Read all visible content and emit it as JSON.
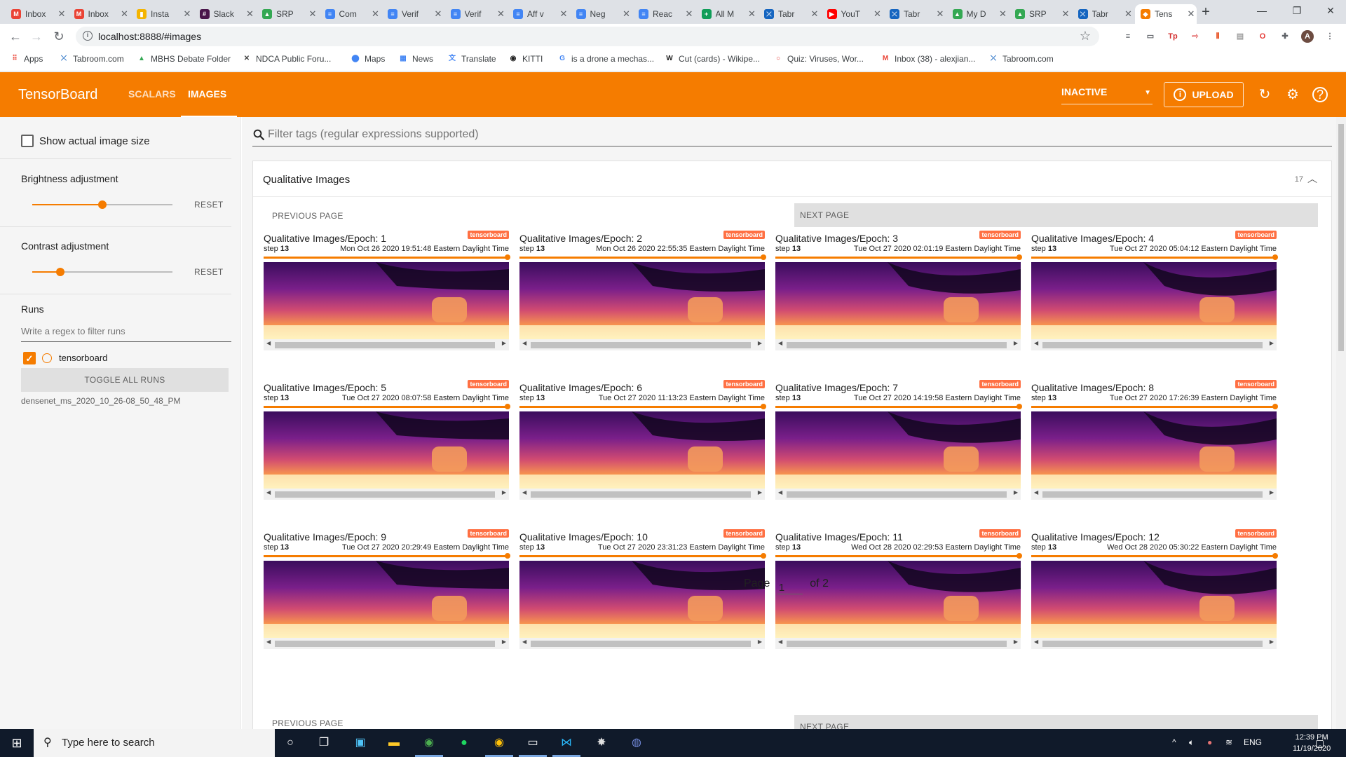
{
  "browser": {
    "tabs": [
      {
        "label": "Inbox",
        "fav": "M",
        "color": "#ea4335"
      },
      {
        "label": "Inbox",
        "fav": "M",
        "color": "#ea4335"
      },
      {
        "label": "Insta",
        "fav": "▮",
        "color": "#f4b400"
      },
      {
        "label": "Slack",
        "fav": "#",
        "color": "#4a154b"
      },
      {
        "label": "SRP",
        "fav": "▲",
        "color": "#34a853"
      },
      {
        "label": "Com",
        "fav": "≡",
        "color": "#4285f4"
      },
      {
        "label": "Verif",
        "fav": "≡",
        "color": "#4285f4"
      },
      {
        "label": "Verif",
        "fav": "≡",
        "color": "#4285f4"
      },
      {
        "label": "Aff v",
        "fav": "≡",
        "color": "#4285f4"
      },
      {
        "label": "Neg",
        "fav": "≡",
        "color": "#4285f4"
      },
      {
        "label": "Reac",
        "fav": "≡",
        "color": "#4285f4"
      },
      {
        "label": "All M",
        "fav": "+",
        "color": "#0f9d58"
      },
      {
        "label": "Tabr",
        "fav": "⤫",
        "color": "#1565c0"
      },
      {
        "label": "YouT",
        "fav": "▶",
        "color": "#ff0000"
      },
      {
        "label": "Tabr",
        "fav": "⤫",
        "color": "#1565c0"
      },
      {
        "label": "My D",
        "fav": "▲",
        "color": "#34a853"
      },
      {
        "label": "SRP",
        "fav": "▲",
        "color": "#34a853"
      },
      {
        "label": "Tabr",
        "fav": "⤫",
        "color": "#1565c0"
      },
      {
        "label": "Tens",
        "fav": "◆",
        "color": "#f57c00",
        "active": true
      }
    ],
    "url": "localhost:8888/#images",
    "bookmarks": [
      {
        "label": "Apps",
        "icon": "apps-grid-icon"
      },
      {
        "label": "Tabroom.com",
        "icon": "tabroom-icon"
      },
      {
        "label": "MBHS Debate Folder",
        "icon": "drive-icon"
      },
      {
        "label": "NDCA Public Foru...",
        "icon": "ndca-icon"
      },
      {
        "label": "Maps",
        "icon": "maps-pin-icon"
      },
      {
        "label": "News",
        "icon": "news-icon"
      },
      {
        "label": "Translate",
        "icon": "translate-icon"
      },
      {
        "label": "KITTI",
        "icon": "github-icon"
      },
      {
        "label": "is a drone a mechas...",
        "icon": "google-icon"
      },
      {
        "label": "Cut (cards) - Wikipe...",
        "icon": "wikipedia-icon"
      },
      {
        "label": "Quiz: Viruses, Wor...",
        "icon": "quiz-icon"
      },
      {
        "label": "Inbox (38) - alexjian...",
        "icon": "gmail-icon"
      },
      {
        "label": "Tabroom.com",
        "icon": "tabroom-icon"
      }
    ]
  },
  "tensorboard": {
    "logo": "TensorBoard",
    "tabs": [
      "SCALARS",
      "IMAGES"
    ],
    "active_tab": "IMAGES",
    "status": "INACTIVE",
    "upload_label": "UPLOAD",
    "accent": "#f57c00"
  },
  "sidebar": {
    "show_actual_size": "Show actual image size",
    "brightness": {
      "label": "Brightness adjustment",
      "reset": "RESET",
      "value": 0.5
    },
    "contrast": {
      "label": "Contrast adjustment",
      "reset": "RESET",
      "value": 0.2
    },
    "runs_title": "Runs",
    "runs_filter_placeholder": "Write a regex to filter runs",
    "run_name": "tensorboard",
    "toggle_all": "TOGGLE ALL RUNS",
    "run_dir": "densenet_ms_2020_10_26-08_50_48_PM"
  },
  "main": {
    "tag_filter_placeholder": "Filter tags (regular expressions supported)",
    "card_title": "Qualitative Images",
    "card_count": "17",
    "prev_page": "PREVIOUS PAGE",
    "next_page": "NEXT PAGE",
    "pager": {
      "label": "Page",
      "current": "1",
      "total_label": "of 2"
    },
    "images": [
      {
        "title": "Qualitative Images/Epoch: 1",
        "run": "tensorboard",
        "step_label": "step",
        "step": "13",
        "time": "Mon Oct 26 2020 19:51:48 Eastern Daylight Time"
      },
      {
        "title": "Qualitative Images/Epoch: 2",
        "run": "tensorboard",
        "step_label": "step",
        "step": "13",
        "time": "Mon Oct 26 2020 22:55:35 Eastern Daylight Time"
      },
      {
        "title": "Qualitative Images/Epoch: 3",
        "run": "tensorboard",
        "step_label": "step",
        "step": "13",
        "time": "Tue Oct 27 2020 02:01:19 Eastern Daylight Time"
      },
      {
        "title": "Qualitative Images/Epoch: 4",
        "run": "tensorboard",
        "step_label": "step",
        "step": "13",
        "time": "Tue Oct 27 2020 05:04:12 Eastern Daylight Time"
      },
      {
        "title": "Qualitative Images/Epoch: 5",
        "run": "tensorboard",
        "step_label": "step",
        "step": "13",
        "time": "Tue Oct 27 2020 08:07:58 Eastern Daylight Time"
      },
      {
        "title": "Qualitative Images/Epoch: 6",
        "run": "tensorboard",
        "step_label": "step",
        "step": "13",
        "time": "Tue Oct 27 2020 11:13:23 Eastern Daylight Time"
      },
      {
        "title": "Qualitative Images/Epoch: 7",
        "run": "tensorboard",
        "step_label": "step",
        "step": "13",
        "time": "Tue Oct 27 2020 14:19:58 Eastern Daylight Time"
      },
      {
        "title": "Qualitative Images/Epoch: 8",
        "run": "tensorboard",
        "step_label": "step",
        "step": "13",
        "time": "Tue Oct 27 2020 17:26:39 Eastern Daylight Time"
      },
      {
        "title": "Qualitative Images/Epoch: 9",
        "run": "tensorboard",
        "step_label": "step",
        "step": "13",
        "time": "Tue Oct 27 2020 20:29:49 Eastern Daylight Time"
      },
      {
        "title": "Qualitative Images/Epoch: 10",
        "run": "tensorboard",
        "step_label": "step",
        "step": "13",
        "time": "Tue Oct 27 2020 23:31:23 Eastern Daylight Time"
      },
      {
        "title": "Qualitative Images/Epoch: 11",
        "run": "tensorboard",
        "step_label": "step",
        "step": "13",
        "time": "Wed Oct 28 2020 02:29:53 Eastern Daylight Time"
      },
      {
        "title": "Qualitative Images/Epoch: 12",
        "run": "tensorboard",
        "step_label": "step",
        "step": "13",
        "time": "Wed Oct 28 2020 05:30:22 Eastern Daylight Time"
      }
    ]
  },
  "taskbar": {
    "search_placeholder": "Type here to search",
    "lang": "ENG",
    "time": "12:39 PM",
    "date": "11/19/2020"
  }
}
